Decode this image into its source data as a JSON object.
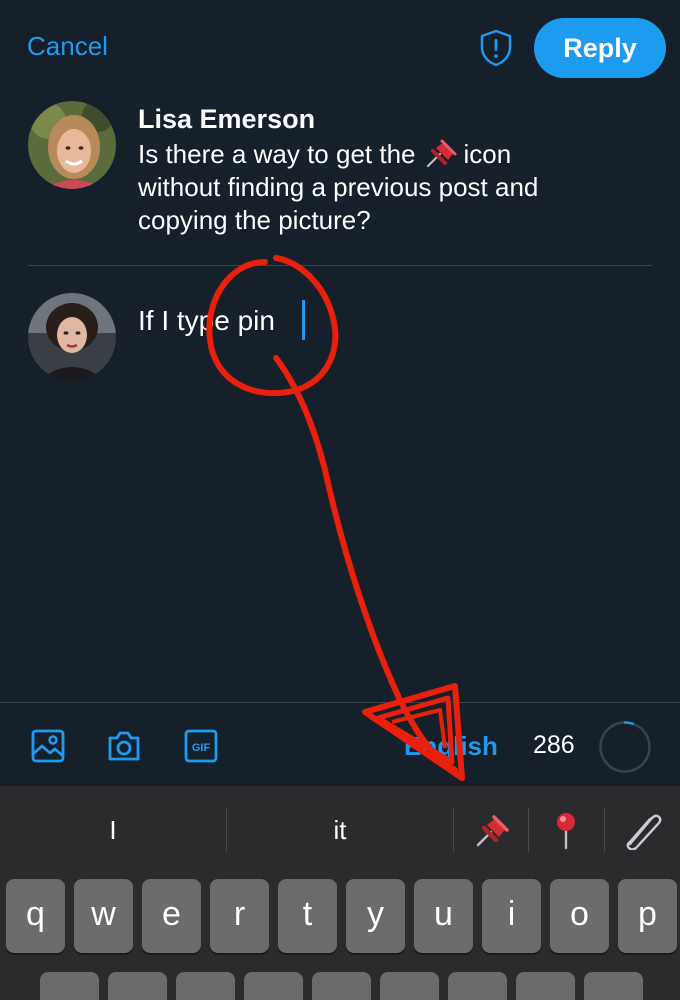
{
  "header": {
    "cancel_label": "Cancel",
    "reply_label": "Reply",
    "shield_icon": "shield-alert-icon"
  },
  "original_post": {
    "author": "Lisa Emerson",
    "text_line1_before": "Is there a way to get the",
    "text_line1_after": "icon",
    "text_line2": "without finding a previous post and",
    "text_line3": "copying the picture?",
    "inline_emoji": "pushpin"
  },
  "reply": {
    "text": "If I type pin"
  },
  "toolbar": {
    "icons": [
      "image-icon",
      "camera-icon",
      "gif-icon"
    ],
    "language": "English",
    "char_count": "286",
    "progress_fraction": 0.05
  },
  "keyboard": {
    "suggestions": [
      "I",
      "it"
    ],
    "emoji_suggestions": [
      "pushpin",
      "round-pushpin",
      "safety-pin"
    ],
    "row1": [
      "q",
      "w",
      "e",
      "r",
      "t",
      "y",
      "u",
      "i",
      "o",
      "p"
    ]
  },
  "colors": {
    "background": "#15202b",
    "accent": "#1d9bf0",
    "annotation": "#e8200c"
  }
}
